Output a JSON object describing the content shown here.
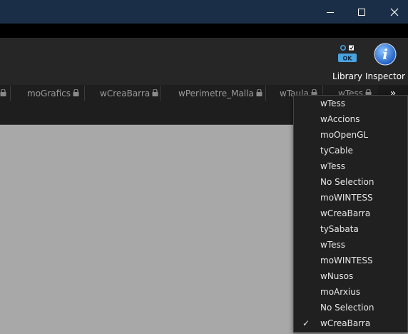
{
  "window": {
    "minimize_icon": "minimize-icon",
    "maximize_icon": "maximize-icon",
    "close_icon": "close-icon"
  },
  "toolbar": {
    "library_label": "Library",
    "inspector_label": "Inspector",
    "ok_badge": "OK",
    "inspector_glyph": "i"
  },
  "tabs": [
    {
      "label": "moGrafics"
    },
    {
      "label": "wCreaBarra"
    },
    {
      "label": "wPerimetre_Malla"
    },
    {
      "label": "wTaula"
    },
    {
      "label": "wTess"
    }
  ],
  "overflow_glyph": "»",
  "dropdown": {
    "items": [
      {
        "label": "wTess",
        "checked": false
      },
      {
        "label": "wAccions",
        "checked": false
      },
      {
        "label": "moOpenGL",
        "checked": false
      },
      {
        "label": "tyCable",
        "checked": false
      },
      {
        "label": "wTess",
        "checked": false
      },
      {
        "label": "No Selection",
        "checked": false
      },
      {
        "label": "moWINTESS",
        "checked": false
      },
      {
        "label": "wCreaBarra",
        "checked": false
      },
      {
        "label": "tySabata",
        "checked": false
      },
      {
        "label": "wTess",
        "checked": false
      },
      {
        "label": "moWINTESS",
        "checked": false
      },
      {
        "label": "wNusos",
        "checked": false
      },
      {
        "label": "moArxius",
        "checked": false
      },
      {
        "label": "No Selection",
        "checked": false
      },
      {
        "label": "wCreaBarra",
        "checked": true
      }
    ],
    "check_glyph": "✓"
  },
  "colors": {
    "titlebar": "#1b2e48",
    "toolbar": "#262626",
    "content": "#a8a8a8",
    "dropdown": "#202020",
    "inspector_blue": "#3a7bd5"
  }
}
